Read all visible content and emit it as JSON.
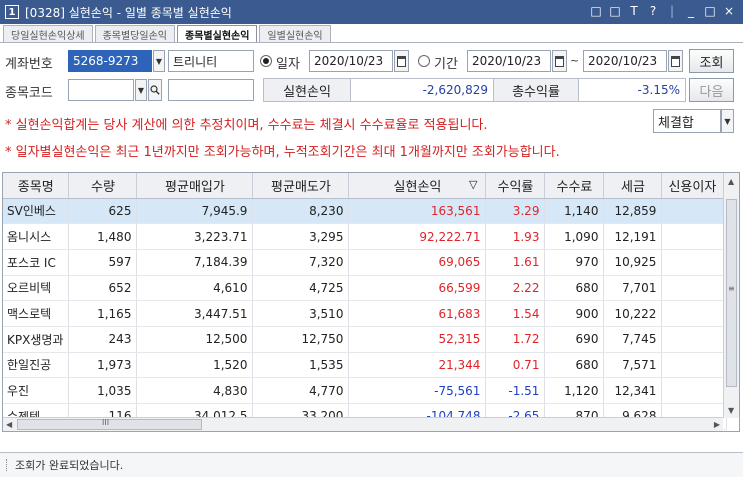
{
  "window": {
    "number": "1",
    "title": "[0328] 실현손익 - 일별 종목별 실현손익",
    "controls": [
      "□",
      "□",
      "T",
      "?",
      "|",
      "_",
      "□",
      "×"
    ]
  },
  "tabs": [
    "당일실현손익상세",
    "종목별당일손익",
    "종목별실현손익",
    "일별실현손익"
  ],
  "active_tab": 2,
  "form": {
    "account_label": "계좌번호",
    "account_value": "5268-9273",
    "account_name": "트리니티",
    "radio_date_label": "일자",
    "date_value": "2020/10/23",
    "radio_period_label": "기간",
    "period_from": "2020/10/23",
    "period_tilde": "~",
    "period_to": "2020/10/23",
    "query_button": "조회",
    "stock_code_label": "종목코드",
    "stock_code_value": "",
    "stock_name_value": "",
    "realized_label": "실현손익",
    "realized_value": "-2,620,829",
    "return_label": "총수익률",
    "return_value": "-3.15%",
    "next_button": "다음",
    "basis_select": "체결합"
  },
  "notices": [
    "* 실현손익합계는 당사 계산에 의한 추정치이며, 수수료는 체결시 수수료율로 적용됩니다.",
    "* 일자별실현손익은 최근 1년까지만 조회가능하며, 누적조회기간은 최대 1개월까지만 조회가능합니다."
  ],
  "table": {
    "columns": [
      "종목명",
      "수량",
      "평균매입가",
      "평균매도가",
      "실현손익",
      "수익률",
      "수수료",
      "세금",
      "신용이자"
    ],
    "sort_indicator": "▽",
    "rows": [
      {
        "name": "SV인베스",
        "qty": "625",
        "avg_buy": "7,945.9",
        "avg_sell": "8,230",
        "pnl": "163,561",
        "rate": "3.29",
        "fee": "1,140",
        "tax": "12,859",
        "sign": "pos"
      },
      {
        "name": "옴니시스",
        "qty": "1,480",
        "avg_buy": "3,223.71",
        "avg_sell": "3,295",
        "pnl": "92,222.71",
        "rate": "1.93",
        "fee": "1,090",
        "tax": "12,191",
        "sign": "pos"
      },
      {
        "name": "포스코 IC",
        "qty": "597",
        "avg_buy": "7,184.39",
        "avg_sell": "7,320",
        "pnl": "69,065",
        "rate": "1.61",
        "fee": "970",
        "tax": "10,925",
        "sign": "pos"
      },
      {
        "name": "오르비텍",
        "qty": "652",
        "avg_buy": "4,610",
        "avg_sell": "4,725",
        "pnl": "66,599",
        "rate": "2.22",
        "fee": "680",
        "tax": "7,701",
        "sign": "pos"
      },
      {
        "name": "맥스로텍",
        "qty": "1,165",
        "avg_buy": "3,447.51",
        "avg_sell": "3,510",
        "pnl": "61,683",
        "rate": "1.54",
        "fee": "900",
        "tax": "10,222",
        "sign": "pos"
      },
      {
        "name": "KPX생명과",
        "qty": "243",
        "avg_buy": "12,500",
        "avg_sell": "12,750",
        "pnl": "52,315",
        "rate": "1.72",
        "fee": "690",
        "tax": "7,745",
        "sign": "pos"
      },
      {
        "name": "한일진공",
        "qty": "1,973",
        "avg_buy": "1,520",
        "avg_sell": "1,535",
        "pnl": "21,344",
        "rate": "0.71",
        "fee": "680",
        "tax": "7,571",
        "sign": "pos"
      },
      {
        "name": "우진",
        "qty": "1,035",
        "avg_buy": "4,830",
        "avg_sell": "4,770",
        "pnl": "-75,561",
        "rate": "-1.51",
        "fee": "1,120",
        "tax": "12,341",
        "sign": "neg"
      },
      {
        "name": "수젠텍",
        "qty": "116",
        "avg_buy": "34,012.5",
        "avg_sell": "33,200",
        "pnl": "-104,748",
        "rate": "-2.65",
        "fee": "870",
        "tax": "9,628",
        "sign": "neg"
      }
    ]
  },
  "scrollbar": {
    "h_thumb_glyph": "III",
    "v_thumb_glyph": "≡"
  },
  "status": "조회가 완료되었습니다."
}
